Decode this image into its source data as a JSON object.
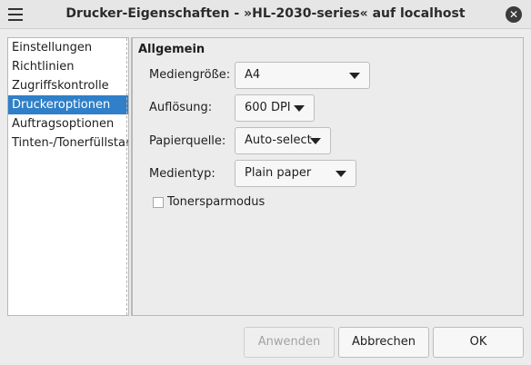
{
  "window": {
    "title": "Drucker-Eigenschaften - »HL-2030-series« auf localhost",
    "close_glyph": "✕"
  },
  "sidebar": {
    "items": [
      {
        "label": "Einstellungen",
        "selected": false
      },
      {
        "label": "Richtlinien",
        "selected": false
      },
      {
        "label": "Zugriffskontrolle",
        "selected": false
      },
      {
        "label": "Druckeroptionen",
        "selected": true
      },
      {
        "label": "Auftragsoptionen",
        "selected": false
      },
      {
        "label": "Tinten-/Tonerfüllstand",
        "selected": false
      }
    ]
  },
  "main": {
    "section_title": "Allgemein",
    "fields": {
      "media_size": {
        "label": "Mediengröße:",
        "value": "A4"
      },
      "resolution": {
        "label": "Auflösung:",
        "value": "600 DPI"
      },
      "paper_source": {
        "label": "Papierquelle:",
        "value": "Auto-select"
      },
      "media_type": {
        "label": "Medientyp:",
        "value": "Plain paper"
      }
    },
    "toner_save": {
      "label": "Tonersparmodus",
      "checked": false
    }
  },
  "buttons": {
    "apply": "Anwenden",
    "cancel": "Abbrechen",
    "ok": "OK"
  },
  "colors": {
    "selection": "#2f80c8",
    "window_bg": "#ececec"
  }
}
